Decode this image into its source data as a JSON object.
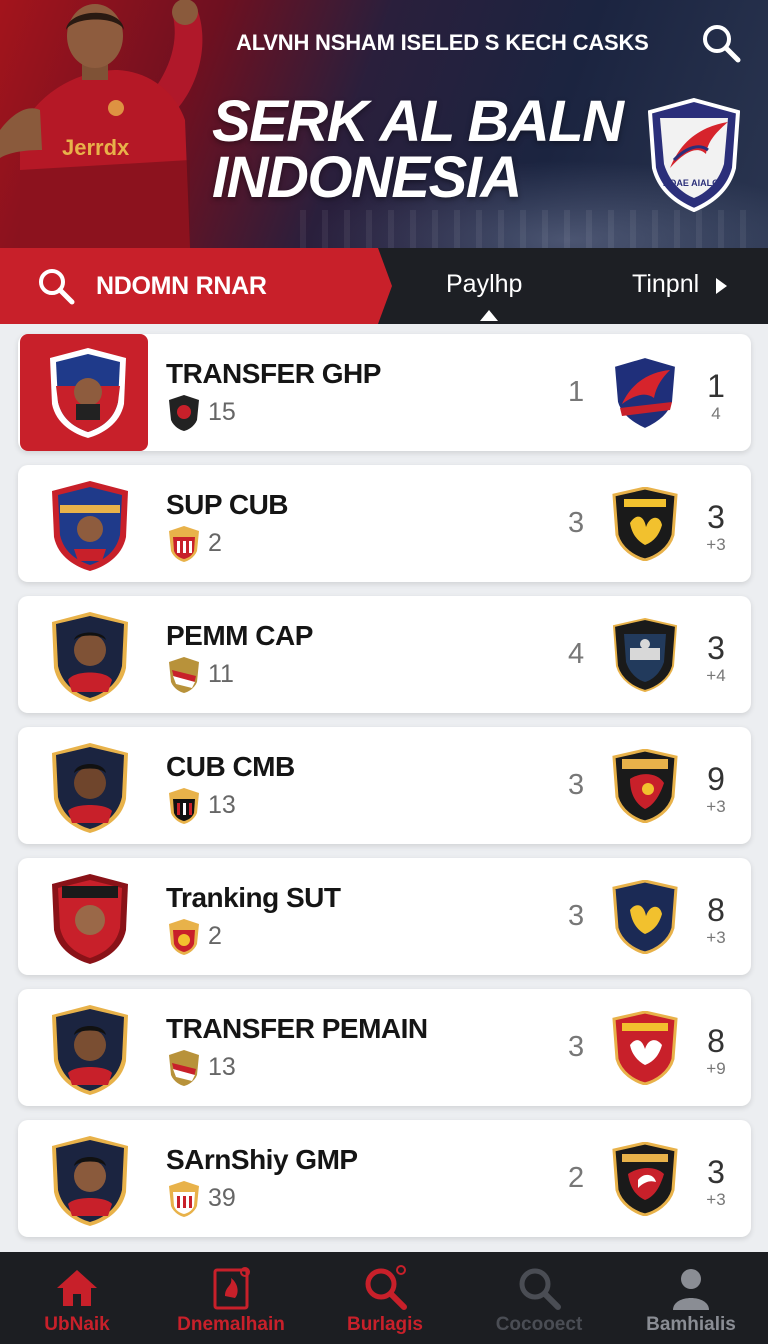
{
  "header": {
    "top_line": "ALVNH NSHAM ISELED S KECH CASKS",
    "title_line1": "SERK AL BALN",
    "title_line2": "INDONESIA",
    "player_jersey_text": "Jerrdx",
    "crest_text": "BOAE AIALOV",
    "search_icon": "search-icon",
    "accent": "#c8202a"
  },
  "navbar": {
    "search_label": "NDOMN RNAR",
    "tab_active": "Paylhp",
    "tab_next": "Tinpnl"
  },
  "items": [
    {
      "name": "TRANSFER GHP",
      "sub": "15",
      "rank": "1",
      "score": "1",
      "score_sub": "4",
      "active": true
    },
    {
      "name": "SUP CUB",
      "sub": "2",
      "rank": "3",
      "score": "3",
      "score_sub": "+3"
    },
    {
      "name": "PEMM CAP",
      "sub": "11",
      "rank": "4",
      "score": "3",
      "score_sub": "+4"
    },
    {
      "name": "CUB CMB",
      "sub": "13",
      "rank": "3",
      "score": "9",
      "score_sub": "+3"
    },
    {
      "name": "Tranking SUT",
      "sub": "2",
      "rank": "3",
      "score": "8",
      "score_sub": "+3"
    },
    {
      "name": "TRANSFER PEMAIN",
      "sub": "13",
      "rank": "3",
      "score": "8",
      "score_sub": "+9"
    },
    {
      "name": "SArnShiy GMP",
      "sub": "39",
      "rank": "2",
      "score": "3",
      "score_sub": "+3"
    }
  ],
  "bottom_nav": [
    {
      "label": "UbNaik",
      "icon": "home-icon",
      "color": "#c8202a"
    },
    {
      "label": "Dnemalhain",
      "icon": "document-icon",
      "color": "#c8202a"
    },
    {
      "label": "Burlagis",
      "icon": "search-icon",
      "color": "#c8202a"
    },
    {
      "label": "Cocooect",
      "icon": "search-icon",
      "color": "#4a4d54"
    },
    {
      "label": "Bamhialis",
      "icon": "profile-icon",
      "color": "#8a8d94"
    }
  ]
}
